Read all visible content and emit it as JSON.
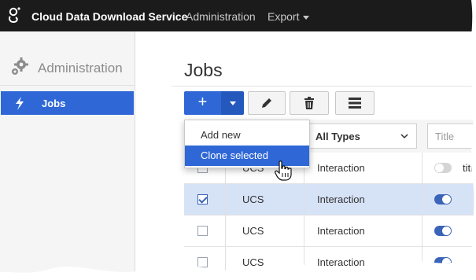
{
  "topbar": {
    "brand": "Cloud Data Download Service",
    "nav_administration": "Administration",
    "nav_export": "Export"
  },
  "sidebar": {
    "title": "Administration",
    "items": [
      {
        "label": "Jobs",
        "active": true
      }
    ]
  },
  "main": {
    "title": "Jobs",
    "toolbar": {
      "add_label": "+"
    },
    "menu": {
      "items": [
        "Add new",
        "Clone selected"
      ],
      "hovered": "Clone selected"
    },
    "filters": {
      "type": "All Types",
      "title_placeholder": "Title"
    },
    "rows": [
      {
        "source": "UCS",
        "type": "Interaction",
        "enabled": false,
        "selected": false,
        "title": "titl"
      },
      {
        "source": "UCS",
        "type": "Interaction",
        "enabled": true,
        "selected": true,
        "title": ""
      },
      {
        "source": "UCS",
        "type": "Interaction",
        "enabled": true,
        "selected": false,
        "title": ""
      },
      {
        "source": "UCS",
        "type": "Interaction",
        "enabled": true,
        "selected": false,
        "title": ""
      }
    ]
  },
  "colors": {
    "accent": "#2f68d6",
    "topbar": "#1b1b1b",
    "selected_row": "#d6e2f6"
  },
  "icons": [
    "genesys-logo-icon",
    "gear-icon",
    "bolt-icon",
    "plus-icon",
    "caret-down-icon",
    "pencil-icon",
    "trash-icon",
    "columns-icon",
    "chevron-down-icon",
    "hand-cursor-icon"
  ]
}
